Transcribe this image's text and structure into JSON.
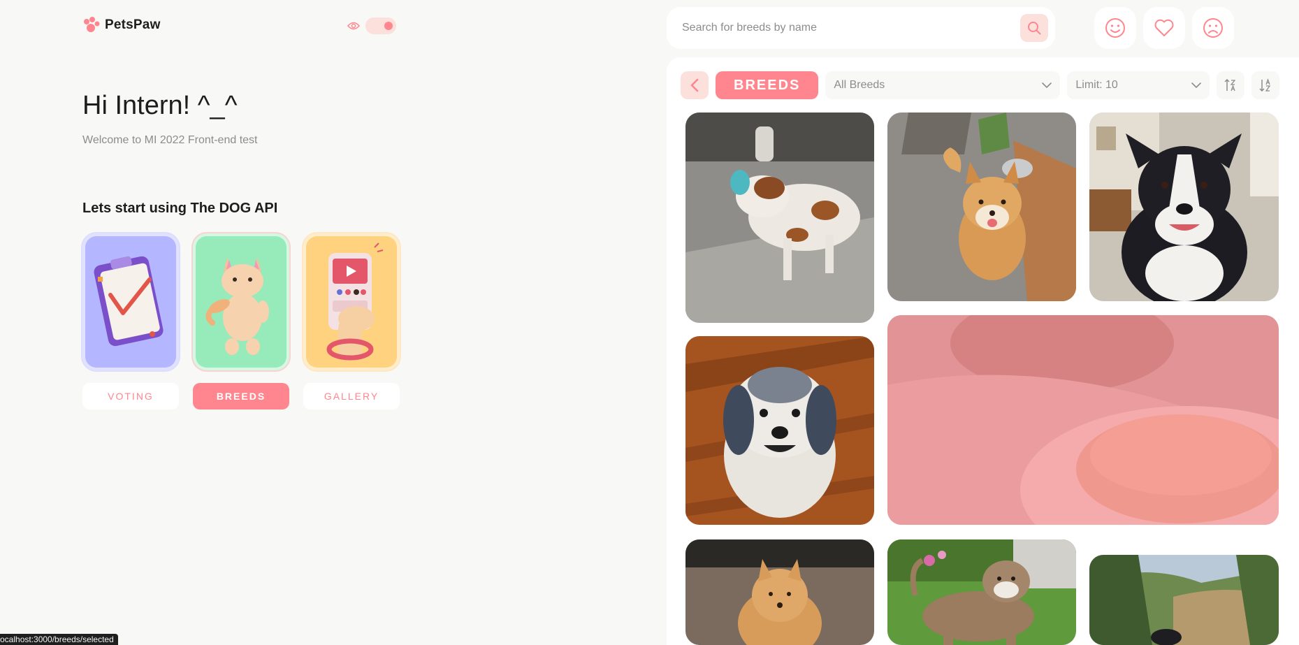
{
  "app": {
    "name": "PetsPaw"
  },
  "colors": {
    "accent": "#FF868E",
    "accent_light": "#FBE0DC",
    "background": "#F8F8F7",
    "text": "#1D1D1D",
    "muted": "#8C8C8C"
  },
  "left": {
    "greeting": "Hi Intern! ^_^",
    "welcome": "Welcome to MI 2022 Front-end test",
    "section_title": "Lets start using The DOG API",
    "cards": [
      {
        "label": "VOTING",
        "icon": "clipboard-check-icon",
        "active": false
      },
      {
        "label": "BREEDS",
        "icon": "cat-toy-icon",
        "active": true
      },
      {
        "label": "GALLERY",
        "icon": "phone-gallery-icon",
        "active": false
      }
    ]
  },
  "header": {
    "search_placeholder": "Search for breeds by name",
    "icons": [
      "smile-icon",
      "heart-icon",
      "sad-face-icon"
    ]
  },
  "breeds_page": {
    "title": "BREEDS",
    "breed_select": "All Breeds",
    "limit_select": "Limit: 10",
    "photos": [
      {
        "subject": "saint-bernard"
      },
      {
        "subject": "shiba-inu"
      },
      {
        "subject": "border-collie"
      },
      {
        "subject": "shaggy-terrier"
      },
      {
        "subject": "bread-on-plate"
      },
      {
        "subject": "fluffy-puppy"
      },
      {
        "subject": "bulldog"
      },
      {
        "subject": "landscape"
      }
    ]
  },
  "status_bar": {
    "url": "ocalhost:3000/breeds/selected"
  }
}
